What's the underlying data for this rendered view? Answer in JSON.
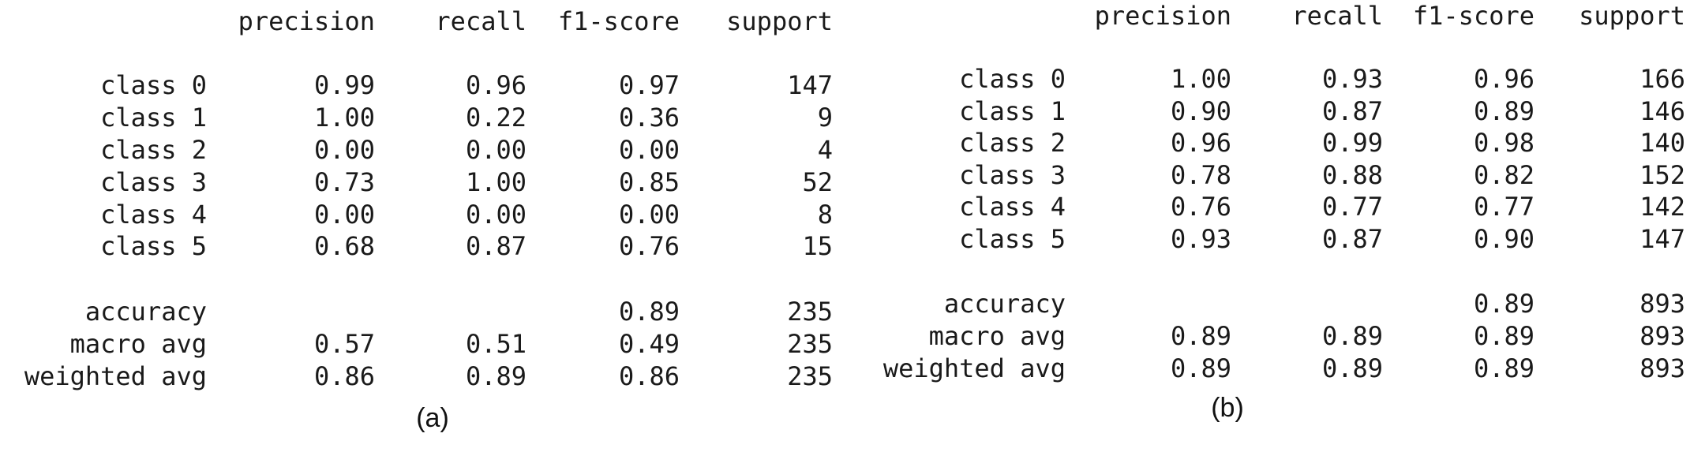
{
  "reports": [
    {
      "caption": "(a)",
      "chart_data": {
        "type": "table",
        "columns": [
          "precision",
          "recall",
          "f1-score",
          "support"
        ],
        "rows": [
          {
            "label": "class 0",
            "values": [
              "0.99",
              "0.96",
              "0.97",
              "147"
            ]
          },
          {
            "label": "class 1",
            "values": [
              "1.00",
              "0.22",
              "0.36",
              "9"
            ]
          },
          {
            "label": "class 2",
            "values": [
              "0.00",
              "0.00",
              "0.00",
              "4"
            ]
          },
          {
            "label": "class 3",
            "values": [
              "0.73",
              "1.00",
              "0.85",
              "52"
            ]
          },
          {
            "label": "class 4",
            "values": [
              "0.00",
              "0.00",
              "0.00",
              "8"
            ]
          },
          {
            "label": "class 5",
            "values": [
              "0.68",
              "0.87",
              "0.76",
              "15"
            ]
          }
        ],
        "summary_rows": [
          {
            "label": "accuracy",
            "values": [
              "",
              "",
              "0.89",
              "235"
            ]
          },
          {
            "label": "macro avg",
            "values": [
              "0.57",
              "0.51",
              "0.49",
              "235"
            ]
          },
          {
            "label": "weighted avg",
            "values": [
              "0.86",
              "0.89",
              "0.86",
              "235"
            ]
          }
        ]
      }
    },
    {
      "caption": "(b)",
      "chart_data": {
        "type": "table",
        "columns": [
          "precision",
          "recall",
          "f1-score",
          "support"
        ],
        "rows": [
          {
            "label": "class 0",
            "values": [
              "1.00",
              "0.93",
              "0.96",
              "166"
            ]
          },
          {
            "label": "class 1",
            "values": [
              "0.90",
              "0.87",
              "0.89",
              "146"
            ]
          },
          {
            "label": "class 2",
            "values": [
              "0.96",
              "0.99",
              "0.98",
              "140"
            ]
          },
          {
            "label": "class 3",
            "values": [
              "0.78",
              "0.88",
              "0.82",
              "152"
            ]
          },
          {
            "label": "class 4",
            "values": [
              "0.76",
              "0.77",
              "0.77",
              "142"
            ]
          },
          {
            "label": "class 5",
            "values": [
              "0.93",
              "0.87",
              "0.90",
              "147"
            ]
          }
        ],
        "summary_rows": [
          {
            "label": "accuracy",
            "values": [
              "",
              "",
              "0.89",
              "893"
            ]
          },
          {
            "label": "macro avg",
            "values": [
              "0.89",
              "0.89",
              "0.89",
              "893"
            ]
          },
          {
            "label": "weighted avg",
            "values": [
              "0.89",
              "0.89",
              "0.89",
              "893"
            ]
          }
        ]
      }
    }
  ]
}
